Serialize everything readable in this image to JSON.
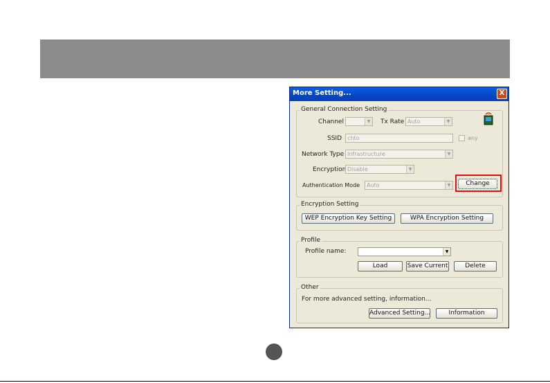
{
  "dialog": {
    "title": "More Setting...",
    "close_symbol": "X",
    "general": {
      "legend": "General Connection Setting",
      "channel_label": "Channel",
      "channel_value": "",
      "tx_rate_label": "Tx Rate",
      "tx_rate_value": "Auto",
      "ssid_label": "SSID",
      "ssid_value": "chto",
      "any_label": "any",
      "network_type_label": "Network Type",
      "network_type_value": "Infrastructure",
      "encryption_label": "Encryption",
      "encryption_value": "Disable",
      "auth_mode_label": "Authentication Mode",
      "auth_mode_value": "Auto",
      "change_button": "Change"
    },
    "encryption": {
      "legend": "Encryption Setting",
      "wep_button": "WEP Encryption Key Setting",
      "wpa_button": "WPA Encryption Setting"
    },
    "profile": {
      "legend": "Profile",
      "name_label": "Profile name:",
      "name_value": "",
      "load_button": "Load",
      "save_button": "Save Current",
      "delete_button": "Delete"
    },
    "other": {
      "legend": "Other",
      "info_text": "For more advanced setting, information...",
      "advanced_button": "Advanced Setting...",
      "information_button": "Information"
    }
  },
  "icons": [
    "wireless-adapter-icon",
    "dropdown-arrow-icon",
    "close-icon"
  ],
  "colors": {
    "titlebar": "#0246c6",
    "dialog_bg": "#ece9d8",
    "highlight": "#e01010",
    "banner": "#8c8c8c"
  }
}
